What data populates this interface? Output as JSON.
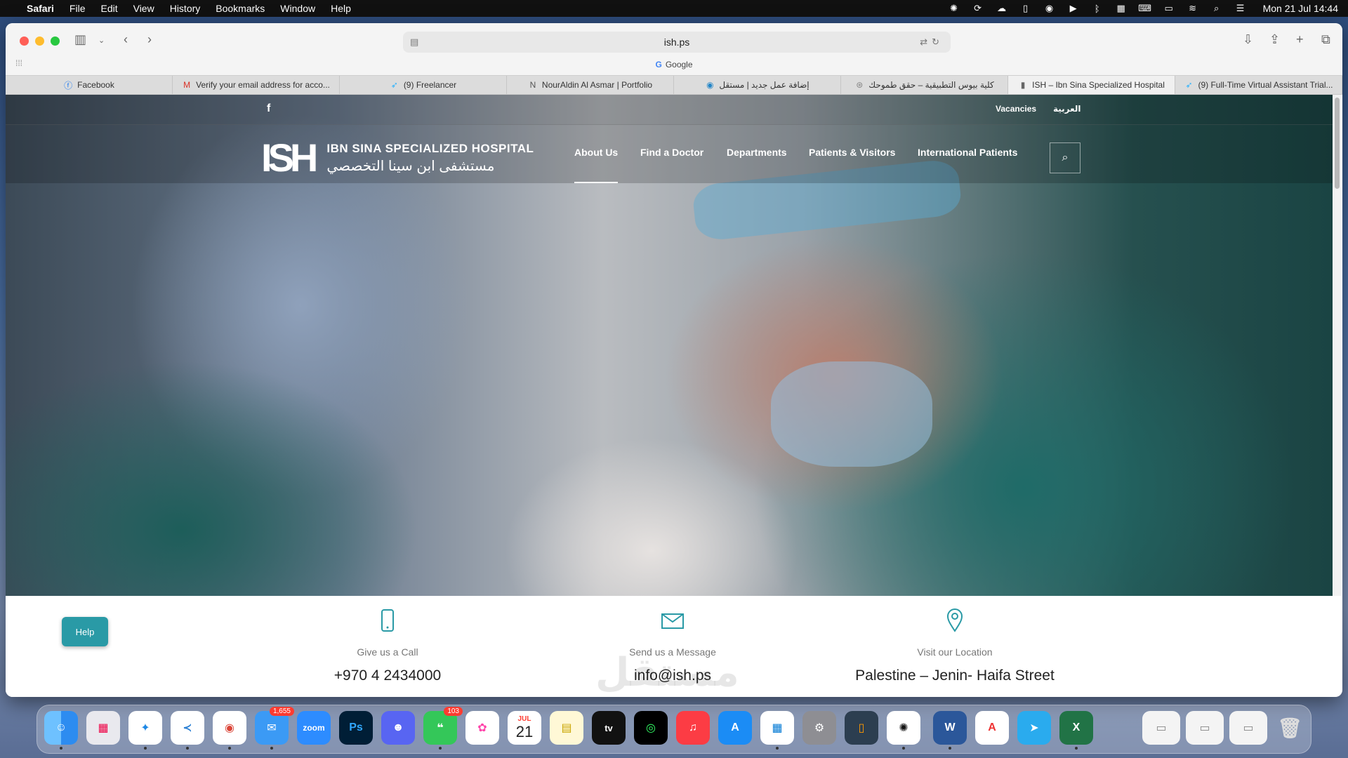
{
  "menubar": {
    "app_name": "Safari",
    "items": [
      "File",
      "Edit",
      "View",
      "History",
      "Bookmarks",
      "Window",
      "Help"
    ],
    "clock": "Mon 21 Jul  14:44"
  },
  "browser": {
    "url": "ish.ps",
    "search_hint": "Google",
    "tabs": [
      {
        "label": "Facebook",
        "icon": "facebook-icon"
      },
      {
        "label": "Verify your email address for acco...",
        "icon": "gmail-icon"
      },
      {
        "label": "(9) Freelancer",
        "icon": "freelancer-icon"
      },
      {
        "label": "NourAldin Al Asmar | Portfolio",
        "icon": "portfolio-icon"
      },
      {
        "label": "إضافة عمل جديد | مستقل",
        "icon": "mostaql-icon"
      },
      {
        "label": "كلية بيوس التطبيقية – حقق طموحك",
        "icon": "college-icon"
      },
      {
        "label": "ISH – Ibn Sina Specialized Hospital",
        "icon": "ish-icon"
      },
      {
        "label": "(9) Full-Time Virtual Assistant Trial...",
        "icon": "freelancer-icon"
      }
    ]
  },
  "site": {
    "top_links": {
      "vacancies": "Vacancies",
      "arabic": "العربية"
    },
    "logo": {
      "mark": "ISH",
      "name_en": "IBN SINA SPECIALIZED HOSPITAL",
      "name_ar": "مستشفى ابن سينا التخصصي"
    },
    "nav": [
      "About Us",
      "Find a Doctor",
      "Departments",
      "Patients & Visitors",
      "International Patients"
    ],
    "contact": [
      {
        "label": "Give us a Call",
        "value": "+970 4 2434000",
        "icon": "phone-icon"
      },
      {
        "label": "Send us a Message",
        "value": "info@ish.ps",
        "icon": "mail-icon"
      },
      {
        "label": "Visit our Location",
        "value": "Palestine – Jenin- Haifa Street",
        "icon": "location-icon"
      }
    ],
    "help_label": "Help"
  },
  "dock": {
    "mail_badge": "1,655",
    "messages_badge": "103",
    "calendar_month": "JUL",
    "calendar_day": "21",
    "zoom_label": "zoom",
    "photoshop_label": "Ps"
  }
}
